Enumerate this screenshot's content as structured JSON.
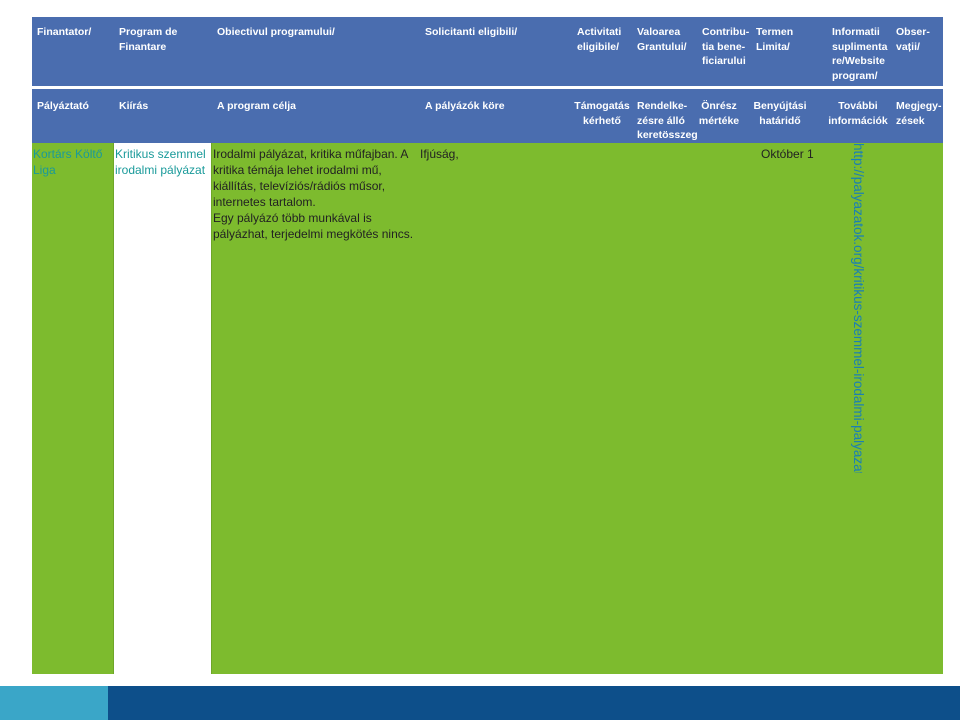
{
  "header_ro": [
    "Finantator/",
    "Program de\nFinantare",
    "Obiectivul programului/",
    "Solicitanti eligibili/",
    "Activitati\neligibile/",
    "Valoarea\nGrantului/",
    "Contribu-\ntia bene-\nficiarului",
    "Termen\nLimita/",
    "Informatii\nsuplimenta\nre/Website\nprogram/",
    "Obser-\nvații/"
  ],
  "header_hu": [
    "Pályáztató",
    "Kiírás",
    "A program célja",
    "A pályázók köre",
    "Támogatás\nkérhető",
    "Rendelke-\nzésre álló\nkeretösszeg",
    "Önrész\nmértéke",
    "Benyújtási\nhatáridő",
    "További\ninformációk",
    "Megjegy-\nzések"
  ],
  "row": {
    "palyaztato": "Kortárs Költő\nLiga",
    "kiiras": "Kritikus szemmel\nirodalmi pályázat",
    "cel": "Irodalmi pályázat, kritika műfajban. A\nkritika témája lehet irodalmi mű,\nkiállítás, televíziós/rádiós műsor,\ninternetes tartalom.\nEgy pályázó több munkával is\npályázhat, terjedelmi megkötés nincs.",
    "kor": "Ifjúság,",
    "hatarido": "Október 1",
    "url": "http://palyazatok.org/kritikus-szemmel-irodalmi-palyazat/"
  },
  "colors": {
    "header_blue": "#4a6daf",
    "body_green": "#7dbb2e",
    "teal_text": "#1a9a9a",
    "link_blue": "#1a7fb5",
    "footer_navy": "#0d4f8a",
    "footer_cyan": "#3aa6c8"
  }
}
